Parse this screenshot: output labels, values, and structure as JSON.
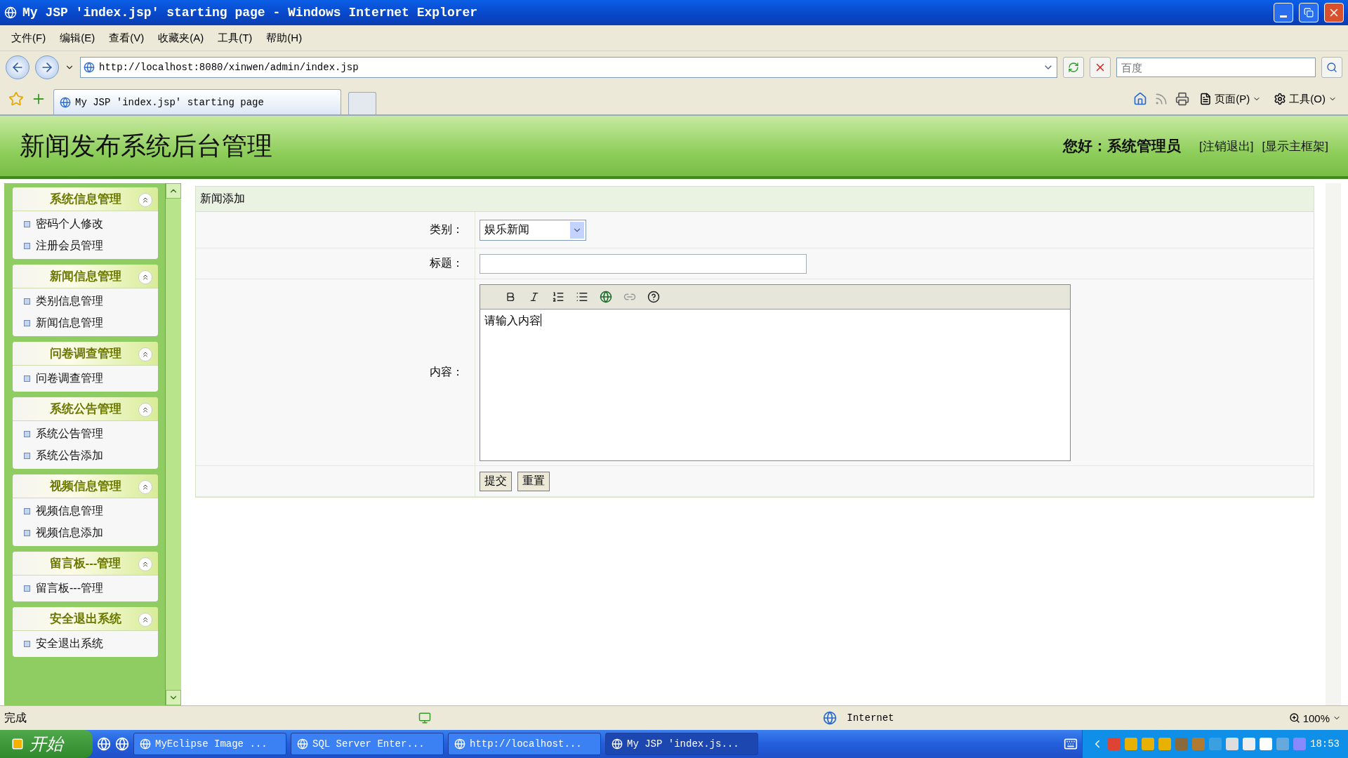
{
  "window": {
    "title": "My JSP 'index.jsp' starting page - Windows Internet Explorer"
  },
  "menu": [
    "文件(F)",
    "编辑(E)",
    "查看(V)",
    "收藏夹(A)",
    "工具(T)",
    "帮助(H)"
  ],
  "address": {
    "url": "http://localhost:8080/xinwen/admin/index.jsp"
  },
  "search": {
    "placeholder": "百度"
  },
  "tabs": [
    {
      "label": "My JSP 'index.jsp' starting page",
      "selected": true
    }
  ],
  "command_bar": [
    "页面(P)",
    "工具(O)"
  ],
  "header": {
    "title": "新闻发布系统后台管理",
    "greeting": "您好：系统管理员",
    "links": [
      "[注销退出]",
      "[显示主框架]"
    ]
  },
  "sidebar": [
    {
      "title": "系统信息管理",
      "expanded": true,
      "items": [
        "密码个人修改",
        "注册会员管理"
      ]
    },
    {
      "title": "新闻信息管理",
      "expanded": true,
      "items": [
        "类别信息管理",
        "新闻信息管理"
      ]
    },
    {
      "title": "问卷调查管理",
      "expanded": true,
      "items": [
        "问卷调查管理"
      ]
    },
    {
      "title": "系统公告管理",
      "expanded": true,
      "items": [
        "系统公告管理",
        "系统公告添加"
      ]
    },
    {
      "title": "视频信息管理",
      "expanded": true,
      "items": [
        "视频信息管理",
        "视频信息添加"
      ]
    },
    {
      "title": "留言板---管理",
      "expanded": true,
      "items": [
        "留言板---管理"
      ]
    },
    {
      "title": "安全退出系统",
      "expanded": true,
      "items": [
        "安全退出系统"
      ]
    }
  ],
  "form": {
    "heading": "新闻添加",
    "category": {
      "label": "类别：",
      "value": "娱乐新闻"
    },
    "title": {
      "label": "标题："
    },
    "content": {
      "label": "内容：",
      "value": "请输入内容"
    },
    "buttons": [
      "提交",
      "重置"
    ]
  },
  "status_bar": {
    "text": "完成",
    "zone": "Internet",
    "zoom": "100%"
  },
  "taskbar": {
    "start": "开始",
    "tasks": [
      {
        "label": "MyEclipse Image ...",
        "selected": false
      },
      {
        "label": "SQL Server Enter...",
        "selected": false
      },
      {
        "label": "http://localhost...",
        "selected": false
      },
      {
        "label": "My JSP 'index.js...",
        "selected": true
      }
    ],
    "clock": "18:53"
  }
}
